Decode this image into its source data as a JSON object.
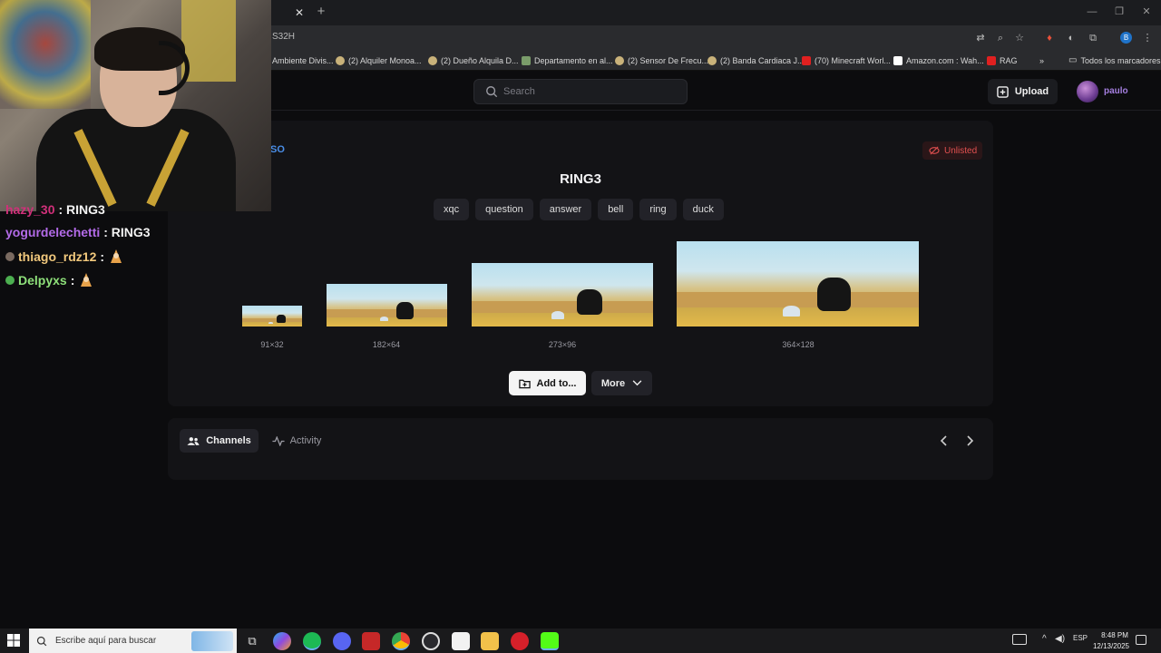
{
  "browser": {
    "url_fragment": "S32H",
    "bookmarks": [
      {
        "label": "Ambiente Divis..."
      },
      {
        "label": "(2) Alquiler Monoa..."
      },
      {
        "label": "(2) Dueño Alquila D..."
      },
      {
        "label": "Departamento en al..."
      },
      {
        "label": "(2) Sensor De Frecu..."
      },
      {
        "label": "(2) Banda Cardiaca J..."
      },
      {
        "label": "(70) Minecraft Worl..."
      },
      {
        "label": "Amazon.com : Wah..."
      },
      {
        "label": "RAG"
      }
    ],
    "overflow_label": "»",
    "all_bookmarks_label": "Todos los marcadores",
    "profile_letter": "B"
  },
  "header": {
    "search_placeholder": "Search",
    "upload_label": "Upload",
    "username": "paulo"
  },
  "emote": {
    "owner_fragment": "SO",
    "visibility_label": "Unlisted",
    "title": "RING3",
    "tags": [
      "xqc",
      "question",
      "answer",
      "bell",
      "ring",
      "duck"
    ],
    "sizes": [
      "91×32",
      "182×64",
      "273×96",
      "364×128"
    ],
    "add_label": "Add to...",
    "more_label": "More"
  },
  "section_tabs": {
    "channels_label": "Channels",
    "activity_label": "Activity"
  },
  "chat": [
    {
      "user": "hazy_30",
      "message": ": RING3",
      "color": "#d0307a"
    },
    {
      "user": "yogurdelechetti",
      "message": ": RING3",
      "color": "#b36be8"
    },
    {
      "user": "thiago_rdz12",
      "message": ":",
      "color": "#f2c97d"
    },
    {
      "user": "Delpyxs",
      "message": ":",
      "color": "#8ee07a"
    }
  ],
  "taskbar": {
    "search_placeholder": "Escribe aquí para buscar",
    "language": "ESP",
    "time": "8:48 PM",
    "date": "12/13/2025"
  },
  "colors": {
    "unlisted": "#e25050",
    "accent": "#a57fe0"
  }
}
